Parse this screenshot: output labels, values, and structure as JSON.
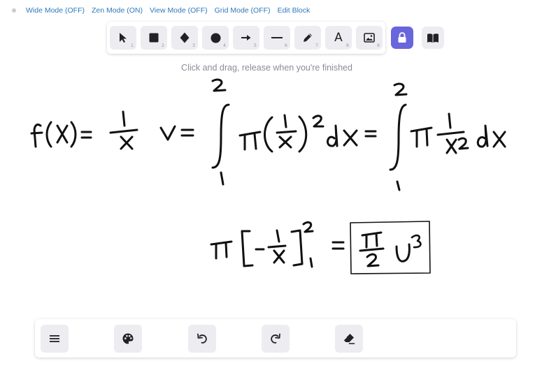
{
  "top_links": [
    "Wide Mode (OFF)",
    "Zen Mode (ON)",
    "View Mode (OFF)",
    "Grid Mode (OFF)",
    "Edit Block"
  ],
  "toolbar": {
    "tools": [
      {
        "name": "selection",
        "icon": "pointer-icon",
        "shortcut": "1"
      },
      {
        "name": "rectangle",
        "icon": "square-icon",
        "shortcut": "2"
      },
      {
        "name": "diamond",
        "icon": "diamond-icon",
        "shortcut": "3"
      },
      {
        "name": "ellipse",
        "icon": "circle-icon",
        "shortcut": "4"
      },
      {
        "name": "arrow",
        "icon": "arrow-icon",
        "shortcut": "5"
      },
      {
        "name": "line",
        "icon": "line-icon",
        "shortcut": "6"
      },
      {
        "name": "draw",
        "icon": "pencil-icon",
        "shortcut": "7"
      },
      {
        "name": "text",
        "icon": "text-icon",
        "glyph": "A",
        "shortcut": "8"
      },
      {
        "name": "image",
        "icon": "image-icon",
        "shortcut": "9"
      }
    ],
    "lock_icon": "lock-icon",
    "library_icon": "book-icon",
    "accent_color": "#6965db"
  },
  "hint": "Click and drag, release when you're finished",
  "drawing": {
    "description": "handwritten volume-of-revolution calculation",
    "boxed_answer": true
  },
  "bottom_toolbar": {
    "buttons": [
      {
        "name": "menu",
        "icon": "hamburger-icon"
      },
      {
        "name": "style",
        "icon": "palette-icon"
      },
      {
        "name": "undo",
        "icon": "undo-icon"
      },
      {
        "name": "redo",
        "icon": "redo-icon"
      },
      {
        "name": "clear",
        "icon": "eraser-icon"
      }
    ]
  }
}
